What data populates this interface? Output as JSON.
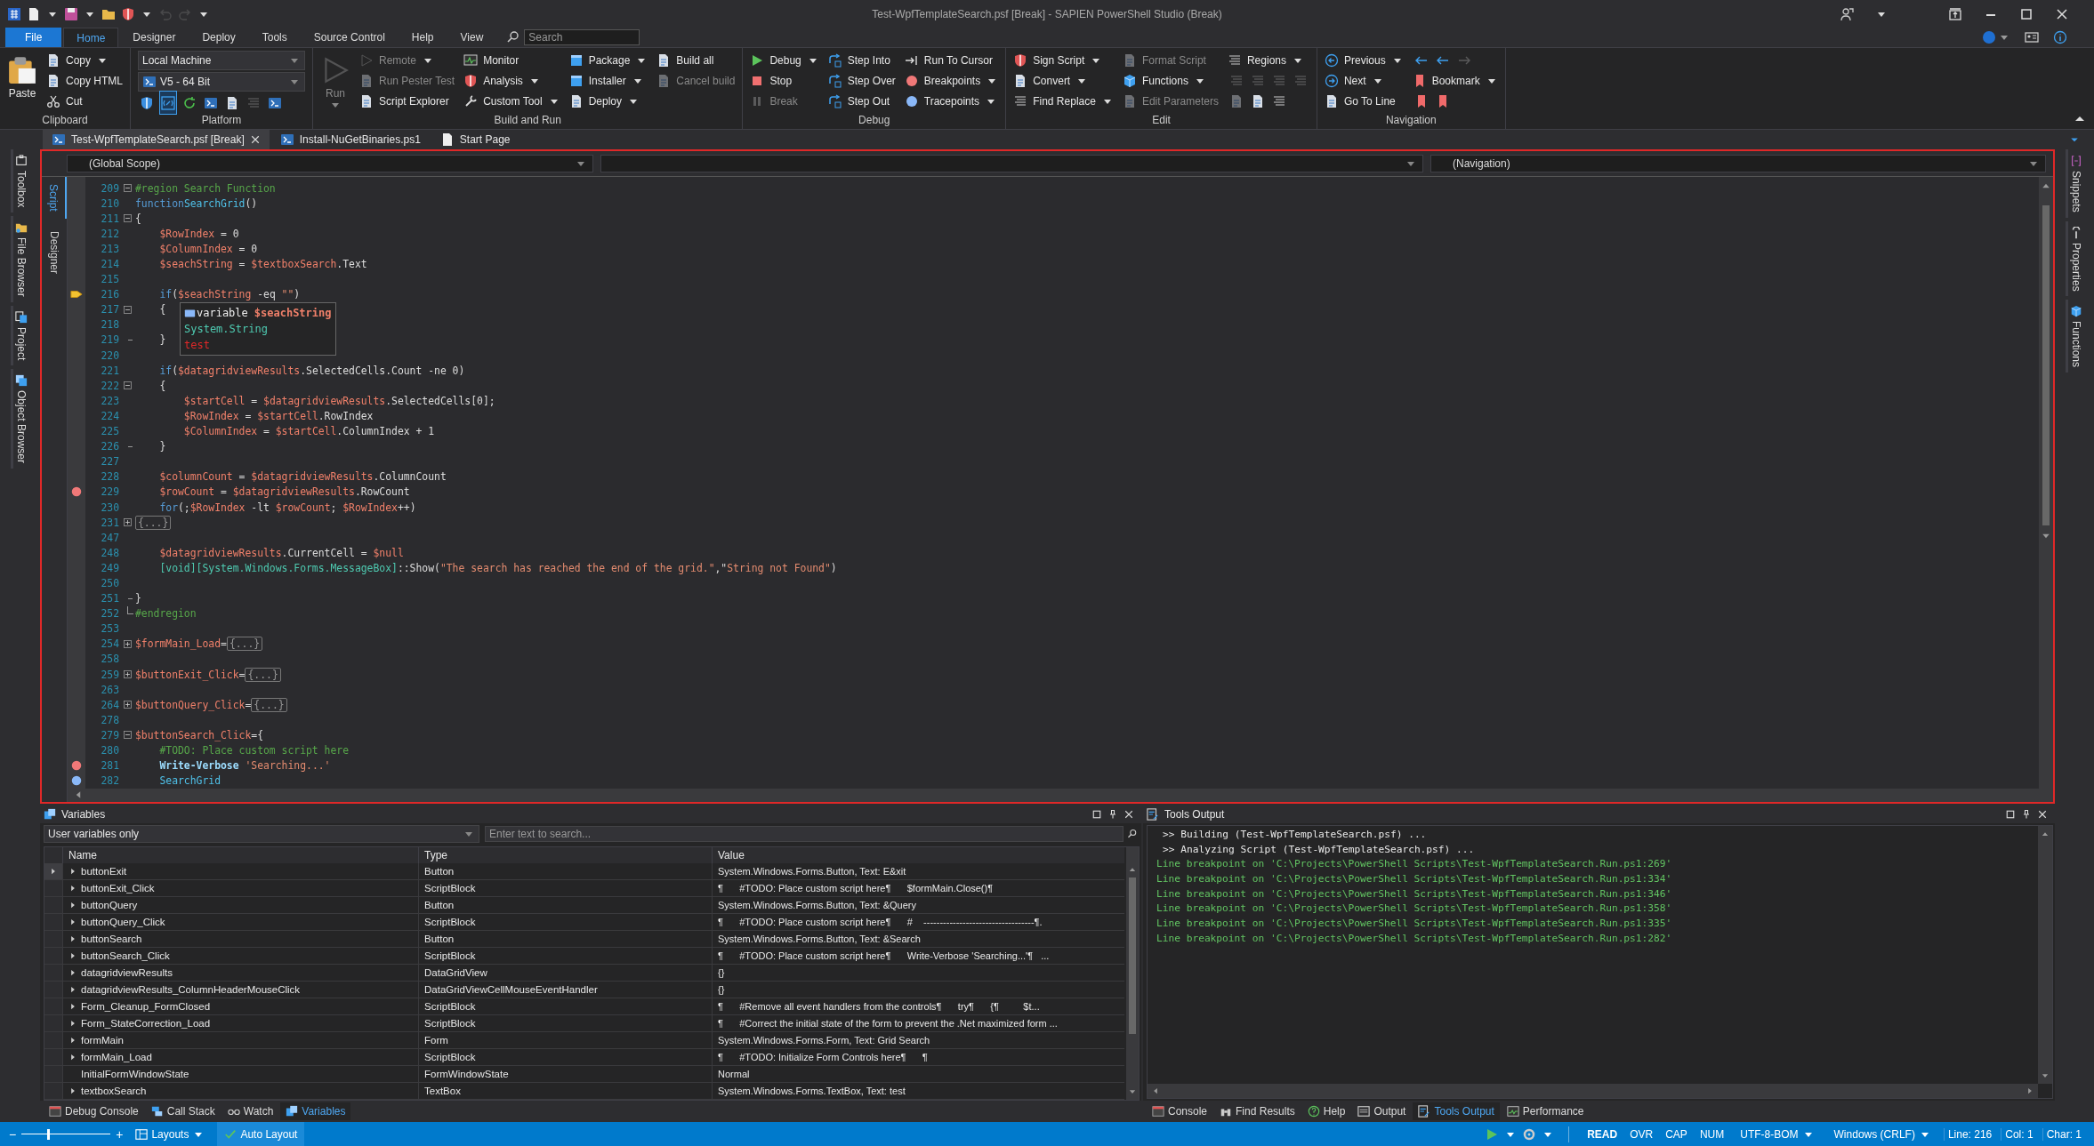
{
  "window": {
    "title": "Test-WpfTemplateSearch.psf [Break] - SAPIEN PowerShell Studio (Break)"
  },
  "menu": [
    {
      "label": "File",
      "kind": "file",
      "selected": false
    },
    {
      "label": "Home",
      "kind": "tab",
      "selected": true
    },
    {
      "label": "Designer",
      "kind": "tab",
      "selected": false
    },
    {
      "label": "Deploy",
      "kind": "tab",
      "selected": false
    },
    {
      "label": "Tools",
      "kind": "tab",
      "selected": false
    },
    {
      "label": "Source Control",
      "kind": "tab",
      "selected": false
    },
    {
      "label": "Help",
      "kind": "tab",
      "selected": false
    },
    {
      "label": "View",
      "kind": "tab",
      "selected": false
    }
  ],
  "search": {
    "placeholder": "Search"
  },
  "ribbon": {
    "groups": [
      {
        "label": "Clipboard",
        "large": {
          "label": "Paste",
          "dropdown": false,
          "disabled": false
        },
        "columns": [
          [
            {
              "kind": "button",
              "label": "Copy",
              "dropdown": true,
              "disabled": false
            },
            {
              "kind": "button",
              "label": "Copy HTML",
              "dropdown": false,
              "disabled": false
            },
            {
              "kind": "button",
              "label": "Cut",
              "dropdown": false,
              "disabled": false
            }
          ]
        ]
      },
      {
        "label": "Platform",
        "columns": [
          [
            {
              "kind": "combo",
              "value": "Local Machine"
            },
            {
              "kind": "combo",
              "value": "V5  -  64 Bit"
            },
            {
              "kind": "icons",
              "icons": [
                {
                  "selected": false,
                  "disabled": false
                },
                {
                  "selected": true,
                  "disabled": false
                },
                {
                  "selected": false,
                  "disabled": false
                },
                {
                  "selected": false,
                  "disabled": false
                },
                {
                  "selected": false,
                  "disabled": false
                },
                {
                  "selected": false,
                  "disabled": true
                },
                {
                  "selected": false,
                  "disabled": false
                }
              ]
            }
          ]
        ]
      },
      {
        "label": "Build and Run",
        "large": {
          "label": "Run",
          "dropdown": true,
          "disabled": true
        },
        "columns": [
          [
            {
              "kind": "button",
              "label": "Remote",
              "dropdown": true,
              "disabled": true
            },
            {
              "kind": "button",
              "label": "Run Pester Test",
              "dropdown": false,
              "disabled": true
            },
            {
              "kind": "button",
              "label": "Script Explorer",
              "dropdown": false,
              "disabled": false
            }
          ],
          [
            {
              "kind": "button",
              "label": "Monitor",
              "dropdown": false,
              "disabled": false
            },
            {
              "kind": "button",
              "label": "Analysis",
              "dropdown": true,
              "disabled": false
            },
            {
              "kind": "button",
              "label": "Custom Tool",
              "dropdown": true,
              "disabled": false
            }
          ],
          [
            {
              "kind": "button",
              "label": "Package",
              "dropdown": true,
              "disabled": false
            },
            {
              "kind": "button",
              "label": "Installer",
              "dropdown": true,
              "disabled": false
            },
            {
              "kind": "button",
              "label": "Deploy",
              "dropdown": true,
              "disabled": false
            }
          ],
          [
            {
              "kind": "button",
              "label": "Build all",
              "dropdown": false,
              "disabled": false
            },
            {
              "kind": "button",
              "label": "Cancel build",
              "dropdown": false,
              "disabled": true
            }
          ]
        ]
      },
      {
        "label": "Debug",
        "columns": [
          [
            {
              "kind": "button",
              "label": "Debug",
              "dropdown": true,
              "disabled": false
            },
            {
              "kind": "button",
              "label": "Stop",
              "dropdown": false,
              "disabled": false
            },
            {
              "kind": "button",
              "label": "Break",
              "dropdown": false,
              "disabled": true
            }
          ],
          [
            {
              "kind": "button",
              "label": "Step Into",
              "dropdown": false,
              "disabled": false
            },
            {
              "kind": "button",
              "label": "Step Over",
              "dropdown": false,
              "disabled": false
            },
            {
              "kind": "button",
              "label": "Step Out",
              "dropdown": false,
              "disabled": false
            }
          ],
          [
            {
              "kind": "button",
              "label": "Run To Cursor",
              "dropdown": false,
              "disabled": false
            },
            {
              "kind": "button",
              "label": "Breakpoints",
              "dropdown": true,
              "disabled": false
            },
            {
              "kind": "button",
              "label": "Tracepoints",
              "dropdown": true,
              "disabled": false
            }
          ]
        ]
      },
      {
        "label": "Edit",
        "columns": [
          [
            {
              "kind": "button",
              "label": "Sign Script",
              "dropdown": true,
              "disabled": false
            },
            {
              "kind": "button",
              "label": "Convert",
              "dropdown": true,
              "disabled": false
            },
            {
              "kind": "button",
              "label": "Find Replace",
              "dropdown": true,
              "disabled": false
            }
          ],
          [
            {
              "kind": "button",
              "label": "Format Script",
              "dropdown": false,
              "disabled": true
            },
            {
              "kind": "button",
              "label": "Functions",
              "dropdown": true,
              "disabled": false
            },
            {
              "kind": "button",
              "label": "Edit Parameters",
              "dropdown": false,
              "disabled": true
            }
          ],
          [
            {
              "kind": "button",
              "label": "Regions",
              "dropdown": true,
              "disabled": false
            },
            {
              "kind": "icons",
              "icons": [
                {
                  "selected": false,
                  "disabled": true
                },
                {
                  "selected": false,
                  "disabled": true
                },
                {
                  "selected": false,
                  "disabled": true
                },
                {
                  "selected": false,
                  "disabled": true
                }
              ]
            },
            {
              "kind": "icons",
              "icons": [
                {
                  "selected": false,
                  "disabled": true
                },
                {
                  "selected": false,
                  "disabled": false
                },
                {
                  "selected": false,
                  "disabled": false
                }
              ]
            }
          ]
        ]
      },
      {
        "label": "Navigation",
        "columns": [
          [
            {
              "kind": "button",
              "label": "Previous",
              "dropdown": true,
              "disabled": false
            },
            {
              "kind": "button",
              "label": "Next",
              "dropdown": true,
              "disabled": false
            },
            {
              "kind": "button",
              "label": "Go To Line",
              "dropdown": false,
              "disabled": false
            }
          ],
          [
            {
              "kind": "icons",
              "icons": [
                {
                  "selected": false,
                  "disabled": false
                },
                {
                  "selected": false,
                  "disabled": false
                },
                {
                  "selected": false,
                  "disabled": true
                }
              ]
            },
            {
              "kind": "button",
              "label": "Bookmark",
              "dropdown": true,
              "disabled": false
            },
            {
              "kind": "icons",
              "icons": [
                {
                  "selected": false,
                  "disabled": false
                },
                {
                  "selected": false,
                  "disabled": false
                }
              ]
            }
          ]
        ]
      }
    ]
  },
  "documents": [
    {
      "label": "Test-WpfTemplateSearch.psf [Break]",
      "selected": true,
      "closable": true
    },
    {
      "label": "Install-NuGetBinaries.ps1",
      "selected": false,
      "closable": false
    },
    {
      "label": "Start Page",
      "selected": false,
      "closable": false
    }
  ],
  "left_sidebar": [
    {
      "label": "Toolbox"
    },
    {
      "label": "File Browser"
    },
    {
      "label": "Project"
    },
    {
      "label": "Object Browser"
    }
  ],
  "right_sidebar": [
    {
      "label": "Snippets"
    },
    {
      "label": "Properties"
    },
    {
      "label": "Functions"
    }
  ],
  "editor": {
    "views": [
      {
        "label": "Script",
        "selected": true
      },
      {
        "label": "Designer",
        "selected": false
      }
    ],
    "scope": "(Global Scope)",
    "navigation": "(Navigation)",
    "lines": [
      {
        "number": "209",
        "fold": {
          "kind": "open"
        },
        "tokens": [
          {
            "kind": "comment",
            "text": "#region Search Function"
          }
        ]
      },
      {
        "number": "210",
        "tokens": [
          {
            "kind": "keyword",
            "text": "function"
          },
          {
            "kind": "function",
            "text": "SearchGrid"
          },
          {
            "kind": "plain",
            "text": "()"
          }
        ]
      },
      {
        "number": "211",
        "fold": {
          "kind": "open"
        },
        "tokens": [
          {
            "kind": "plain",
            "text": "{"
          }
        ]
      },
      {
        "number": "212",
        "tokens": [
          {
            "kind": "variable",
            "text": "    $RowIndex"
          },
          {
            "kind": "plain",
            "text": " = 0"
          }
        ]
      },
      {
        "number": "213",
        "tokens": [
          {
            "kind": "variable",
            "text": "    $ColumnIndex"
          },
          {
            "kind": "plain",
            "text": " = 0"
          }
        ]
      },
      {
        "number": "214",
        "tokens": [
          {
            "kind": "variable",
            "text": "    $seachString"
          },
          {
            "kind": "plain",
            "text": " = "
          },
          {
            "kind": "variable",
            "text": "$textboxSearch"
          },
          {
            "kind": "plain",
            "text": ".Text"
          }
        ]
      },
      {
        "number": "215"
      },
      {
        "number": "216",
        "gutter": {
          "kind": "current"
        },
        "tokens": [
          {
            "kind": "keyword",
            "text": "    if"
          },
          {
            "kind": "plain",
            "text": "("
          },
          {
            "kind": "variable",
            "text": "$seachString"
          },
          {
            "kind": "plain",
            "text": " -eq "
          },
          {
            "kind": "string",
            "text": "\"\""
          },
          {
            "kind": "plain",
            "text": ")"
          }
        ]
      },
      {
        "number": "217",
        "fold": {
          "kind": "open"
        },
        "tokens": [
          {
            "kind": "plain",
            "text": "    {"
          }
        ]
      },
      {
        "number": "218"
      },
      {
        "number": "219",
        "fold": {
          "kind": "end"
        },
        "tokens": [
          {
            "kind": "plain",
            "text": "    }"
          }
        ]
      },
      {
        "number": "220"
      },
      {
        "number": "221",
        "tokens": [
          {
            "kind": "keyword",
            "text": "    if"
          },
          {
            "kind": "plain",
            "text": "("
          },
          {
            "kind": "variable",
            "text": "$datagridviewResults"
          },
          {
            "kind": "plain",
            "text": ".SelectedCells.Count -ne 0)"
          }
        ]
      },
      {
        "number": "222",
        "fold": {
          "kind": "open"
        },
        "tokens": [
          {
            "kind": "plain",
            "text": "    {"
          }
        ]
      },
      {
        "number": "223",
        "tokens": [
          {
            "kind": "variable",
            "text": "        $startCell"
          },
          {
            "kind": "plain",
            "text": " = "
          },
          {
            "kind": "variable",
            "text": "$datagridviewResults"
          },
          {
            "kind": "plain",
            "text": ".SelectedCells[0];"
          }
        ]
      },
      {
        "number": "224",
        "tokens": [
          {
            "kind": "variable",
            "text": "        $RowIndex"
          },
          {
            "kind": "plain",
            "text": " = "
          },
          {
            "kind": "variable",
            "text": "$startCell"
          },
          {
            "kind": "plain",
            "text": ".RowIndex"
          }
        ]
      },
      {
        "number": "225",
        "tokens": [
          {
            "kind": "variable",
            "text": "        $ColumnIndex"
          },
          {
            "kind": "plain",
            "text": " = "
          },
          {
            "kind": "variable",
            "text": "$startCell"
          },
          {
            "kind": "plain",
            "text": ".ColumnIndex + 1"
          }
        ]
      },
      {
        "number": "226",
        "fold": {
          "kind": "end"
        },
        "tokens": [
          {
            "kind": "plain",
            "text": "    }"
          }
        ]
      },
      {
        "number": "227"
      },
      {
        "number": "228",
        "tokens": [
          {
            "kind": "variable",
            "text": "    $columnCount"
          },
          {
            "kind": "plain",
            "text": " = "
          },
          {
            "kind": "variable",
            "text": "$datagridviewResults"
          },
          {
            "kind": "plain",
            "text": ".ColumnCount"
          }
        ]
      },
      {
        "number": "229",
        "gutter": {
          "kind": "breakpoint"
        },
        "tokens": [
          {
            "kind": "variable",
            "text": "    $rowCount"
          },
          {
            "kind": "plain",
            "text": " = "
          },
          {
            "kind": "variable",
            "text": "$datagridviewResults"
          },
          {
            "kind": "plain",
            "text": ".RowCount"
          }
        ]
      },
      {
        "number": "230",
        "tokens": [
          {
            "kind": "keyword",
            "text": "    for"
          },
          {
            "kind": "plain",
            "text": "(;"
          },
          {
            "kind": "variable",
            "text": "$RowIndex"
          },
          {
            "kind": "plain",
            "text": " -lt "
          },
          {
            "kind": "variable",
            "text": "$rowCount"
          },
          {
            "kind": "plain",
            "text": "; "
          },
          {
            "kind": "variable",
            "text": "$RowIndex"
          },
          {
            "kind": "plain",
            "text": "++)"
          }
        ]
      },
      {
        "number": "231",
        "fold": {
          "kind": "closed"
        },
        "tokens": [
          {
            "kind": "collapsed",
            "text": "{...}"
          }
        ]
      },
      {
        "number": "247"
      },
      {
        "number": "248",
        "tokens": [
          {
            "kind": "variable",
            "text": "    $datagridviewResults"
          },
          {
            "kind": "plain",
            "text": ".CurrentCell = "
          },
          {
            "kind": "variable",
            "text": "$null"
          }
        ]
      },
      {
        "number": "249",
        "tokens": [
          {
            "kind": "type",
            "text": "    [void][System.Windows.Forms.MessageBox]"
          },
          {
            "kind": "plain",
            "text": "::Show("
          },
          {
            "kind": "string",
            "text": "\"The search has reached the end of the grid.\""
          },
          {
            "kind": "plain",
            "text": ",\""
          },
          {
            "kind": "string",
            "text": "String not Found\""
          },
          {
            "kind": "plain",
            "text": ")"
          }
        ]
      },
      {
        "number": "250"
      },
      {
        "number": "251",
        "fold": {
          "kind": "end"
        },
        "tokens": [
          {
            "kind": "plain",
            "text": "}"
          }
        ]
      },
      {
        "number": "252",
        "fold": {
          "kind": "last"
        },
        "tokens": [
          {
            "kind": "comment",
            "text": "#endregion"
          }
        ]
      },
      {
        "number": "253"
      },
      {
        "number": "254",
        "fold": {
          "kind": "closed"
        },
        "tokens": [
          {
            "kind": "variable",
            "text": "$formMain_Load"
          },
          {
            "kind": "plain",
            "text": "="
          },
          {
            "kind": "collapsed",
            "text": "{...}"
          }
        ]
      },
      {
        "number": "258"
      },
      {
        "number": "259",
        "fold": {
          "kind": "closed"
        },
        "tokens": [
          {
            "kind": "variable",
            "text": "$buttonExit_Click"
          },
          {
            "kind": "plain",
            "text": "="
          },
          {
            "kind": "collapsed",
            "text": "{...}"
          }
        ]
      },
      {
        "number": "263"
      },
      {
        "number": "264",
        "fold": {
          "kind": "closed"
        },
        "tokens": [
          {
            "kind": "variable",
            "text": "$buttonQuery_Click"
          },
          {
            "kind": "plain",
            "text": "="
          },
          {
            "kind": "collapsed",
            "text": "{...}"
          }
        ]
      },
      {
        "number": "278"
      },
      {
        "number": "279",
        "fold": {
          "kind": "open"
        },
        "tokens": [
          {
            "kind": "variable",
            "text": "$buttonSearch_Click"
          },
          {
            "kind": "plain",
            "text": "={"
          }
        ]
      },
      {
        "number": "280",
        "tokens": [
          {
            "kind": "comment",
            "text": "    #TODO: Place custom script here"
          }
        ]
      },
      {
        "number": "281",
        "gutter": {
          "kind": "breakpoint"
        },
        "tokens": [
          {
            "kind": "cmdlet",
            "text": "    Write-Verbose"
          },
          {
            "kind": "string",
            "text": " 'Searching...'"
          }
        ]
      },
      {
        "number": "282",
        "gutter": {
          "kind": "tracepoint"
        },
        "tokens": [
          {
            "kind": "function",
            "text": "    SearchGrid"
          }
        ]
      }
    ],
    "tooltip": {
      "label": "variable",
      "name": "$seachString",
      "type": "System.String",
      "value": "test"
    }
  },
  "variables": {
    "title": "Variables",
    "filter": "User variables only",
    "search": {
      "placeholder": "Enter text to search..."
    },
    "columns": [
      "Name",
      "Type",
      "Value"
    ],
    "rows": [
      {
        "name": "buttonExit",
        "type": "Button",
        "value": "System.Windows.Forms.Button, Text: E&xit",
        "expandable": true,
        "current": true
      },
      {
        "name": "buttonExit_Click",
        "type": "ScriptBlock",
        "value": "¶      #TODO: Place custom script here¶      $formMain.Close()¶",
        "expandable": true,
        "current": false
      },
      {
        "name": "buttonQuery",
        "type": "Button",
        "value": "System.Windows.Forms.Button, Text: &Query",
        "expandable": true,
        "current": false
      },
      {
        "name": "buttonQuery_Click",
        "type": "ScriptBlock",
        "value": "¶      #TODO: Place custom script here¶      #    ----------------------------------¶.",
        "expandable": true,
        "current": false
      },
      {
        "name": "buttonSearch",
        "type": "Button",
        "value": "System.Windows.Forms.Button, Text: &Search",
        "expandable": true,
        "current": false
      },
      {
        "name": "buttonSearch_Click",
        "type": "ScriptBlock",
        "value": "¶      #TODO: Place custom script here¶      Write-Verbose 'Searching...'¶   ...",
        "expandable": true,
        "current": false
      },
      {
        "name": "datagridviewResults",
        "type": "DataGridView",
        "value": "{}",
        "expandable": true,
        "current": false
      },
      {
        "name": "datagridviewResults_ColumnHeaderMouseClick",
        "type": "DataGridViewCellMouseEventHandler",
        "value": "{}",
        "expandable": true,
        "current": false
      },
      {
        "name": "Form_Cleanup_FormClosed",
        "type": "ScriptBlock",
        "value": "¶      #Remove all event handlers from the controls¶      try¶      {¶         $t...",
        "expandable": true,
        "current": false
      },
      {
        "name": "Form_StateCorrection_Load",
        "type": "ScriptBlock",
        "value": "¶      #Correct the initial state of the form to prevent the .Net maximized form ...",
        "expandable": true,
        "current": false
      },
      {
        "name": "formMain",
        "type": "Form",
        "value": "System.Windows.Forms.Form, Text: Grid Search",
        "expandable": true,
        "current": false
      },
      {
        "name": "formMain_Load",
        "type": "ScriptBlock",
        "value": "¶      #TODO: Initialize Form Controls here¶      ¶",
        "expandable": true,
        "current": false
      },
      {
        "name": "InitialFormWindowState",
        "type": "FormWindowState",
        "value": "Normal",
        "expandable": false,
        "current": false
      },
      {
        "name": "textboxSearch",
        "type": "TextBox",
        "value": "System.Windows.Forms.TextBox, Text: test",
        "expandable": true,
        "current": false
      }
    ],
    "tabs": [
      {
        "label": "Debug Console",
        "selected": false
      },
      {
        "label": "Call Stack",
        "selected": false
      },
      {
        "label": "Watch",
        "selected": false
      },
      {
        "label": "Variables",
        "selected": true
      }
    ]
  },
  "tools_output": {
    "title": "Tools Output",
    "lines": [
      {
        "kind": "info",
        "text": ">> Building (Test-WpfTemplateSearch.psf) ..."
      },
      {
        "kind": "info",
        "text": ">> Analyzing Script (Test-WpfTemplateSearch.psf) ..."
      },
      {
        "kind": "breakpoint",
        "text": "Line breakpoint on 'C:\\Projects\\PowerShell Scripts\\Test-WpfTemplateSearch.Run.ps1:269'"
      },
      {
        "kind": "breakpoint",
        "text": "Line breakpoint on 'C:\\Projects\\PowerShell Scripts\\Test-WpfTemplateSearch.Run.ps1:334'"
      },
      {
        "kind": "breakpoint",
        "text": "Line breakpoint on 'C:\\Projects\\PowerShell Scripts\\Test-WpfTemplateSearch.Run.ps1:346'"
      },
      {
        "kind": "breakpoint",
        "text": "Line breakpoint on 'C:\\Projects\\PowerShell Scripts\\Test-WpfTemplateSearch.Run.ps1:358'"
      },
      {
        "kind": "breakpoint",
        "text": "Line breakpoint on 'C:\\Projects\\PowerShell Scripts\\Test-WpfTemplateSearch.Run.ps1:335'"
      },
      {
        "kind": "breakpoint",
        "text": "Line breakpoint on 'C:\\Projects\\PowerShell Scripts\\Test-WpfTemplateSearch.Run.ps1:282'"
      }
    ],
    "tabs": [
      {
        "label": "Console",
        "selected": false
      },
      {
        "label": "Find Results",
        "selected": false
      },
      {
        "label": "Help",
        "selected": false
      },
      {
        "label": "Output",
        "selected": false
      },
      {
        "label": "Tools Output",
        "selected": true
      },
      {
        "label": "Performance",
        "selected": false
      }
    ]
  },
  "status_bar": {
    "zoom": {
      "minus": "−",
      "plus": "+",
      "level": 0.3
    },
    "layouts": "Layouts",
    "auto_layout": {
      "label": "Auto Layout",
      "checked": true
    },
    "modes": [
      {
        "label": "READ",
        "active": true
      },
      {
        "label": "OVR",
        "active": false
      },
      {
        "label": "CAP",
        "active": false
      },
      {
        "label": "NUM",
        "active": false
      }
    ],
    "encoding": "UTF-8-BOM",
    "line_endings": "Windows (CRLF)",
    "position": [
      "Line: 216",
      "Col: 1",
      "Char: 1"
    ]
  }
}
